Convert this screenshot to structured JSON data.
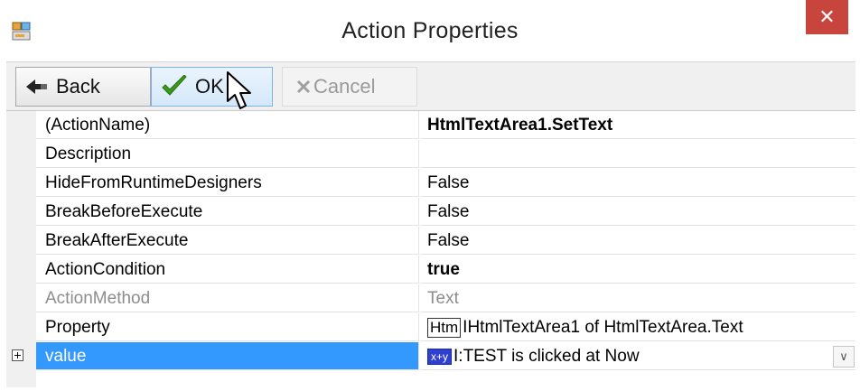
{
  "window": {
    "title": "Action Properties",
    "close_symbol": "✕"
  },
  "toolbar": {
    "back_label": "Back",
    "ok_label": "OK",
    "cancel_label": "Cancel"
  },
  "properties": [
    {
      "name": "(ActionName)",
      "value": "HtmlTextArea1.SetText",
      "value_bold": true
    },
    {
      "name": "Description",
      "value": ""
    },
    {
      "name": "HideFromRuntimeDesigners",
      "value": "False"
    },
    {
      "name": "BreakBeforeExecute",
      "value": "False"
    },
    {
      "name": "BreakAfterExecute",
      "value": "False"
    },
    {
      "name": "ActionCondition",
      "value": "true",
      "value_bold": true
    },
    {
      "name": "ActionMethod",
      "value": "Text",
      "disabled": true
    },
    {
      "name": "Property",
      "badge": "Htm",
      "prefix": "I",
      "value": "HtmlTextArea1 of HtmlTextArea.Text"
    },
    {
      "name": "value",
      "badge": "x+y",
      "prefix": "I",
      "value": ":TEST is clicked at Now",
      "selected": true,
      "expander": "+"
    }
  ],
  "icons": {
    "app": "app-window-icon",
    "back": "back-arrow-icon",
    "ok": "checkmark-icon",
    "cancel": "x-icon",
    "dropdown": "chevron-down-icon"
  },
  "colors": {
    "close_button": "#c7453c",
    "selection": "#3399ff",
    "ok_check": "#3a9a1a"
  }
}
